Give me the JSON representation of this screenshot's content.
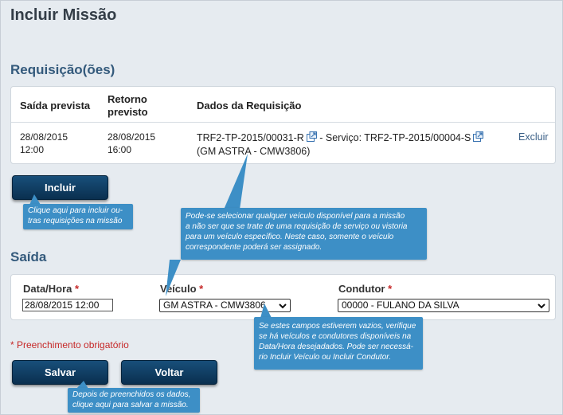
{
  "page": {
    "title": "Incluir Missão"
  },
  "requisicoes": {
    "title": "Requisição(ões)",
    "columns": {
      "saida": "Saída prevista",
      "retorno_line1": "Retorno",
      "retorno_line2": "previsto",
      "dados": "Dados da Requisição"
    },
    "rows": [
      {
        "saida_date": "28/08/2015",
        "saida_time": "12:00",
        "retorno_date": "28/08/2015",
        "retorno_time": "16:00",
        "requisicao": "TRF2-TP-2015/00031-R",
        "servico_prefix": " - Serviço: TRF2-TP-2015/00004-S",
        "veiculo": "(GM ASTRA - CMW3806)",
        "action": "Excluir"
      }
    ],
    "incluir_button": "Incluir"
  },
  "saida": {
    "title": "Saída",
    "data_hora_label": "Data/Hora",
    "data_hora_value": "28/08/2015 12:00",
    "veiculo_label": "Veículo",
    "veiculo_value": "GM ASTRA - CMW3806",
    "condutor_label": "Condutor",
    "condutor_value": "00000 - FULANO DA SILVA",
    "required_mark": "*"
  },
  "form": {
    "required_note": "* Preenchimento obrigatório",
    "save_button": "Salvar",
    "back_button": "Voltar"
  },
  "callouts": {
    "incluir_line1": "Clique aqui para  incluir ou-",
    "incluir_line2": "tras requisições na missão",
    "veiculo_line1": "Pode-se selecionar qualquer veículo disponível para a missão",
    "veiculo_line2": "a não ser que se trate de uma requisição de serviço ou vistoria",
    "veiculo_line3": "para um veículo específico.  Neste caso, somente o veículo",
    "veiculo_line4": "correspondente poderá ser assignado.",
    "campos_line1": "Se estes campos estiverem vazios, verifique",
    "campos_line2": "se há veículos e condutores disponíveis na",
    "campos_line3": "Data/Hora desejadados. Pode ser necessá-",
    "campos_line4": "rio Incluir Veículo ou Incluir Condutor.",
    "salvar_line1": "Depois de preenchidos os dados,",
    "salvar_line2": "clique aqui para salvar a missão."
  },
  "colors": {
    "button_dark_blue": "#0f3f66",
    "callout_blue": "#3d8fc6",
    "section_title": "#345a7c",
    "required_red": "#c62828",
    "background": "#e6ebf0"
  },
  "icons": {
    "external_link": "external-link-icon",
    "dropdown": "chevron-down-icon"
  }
}
